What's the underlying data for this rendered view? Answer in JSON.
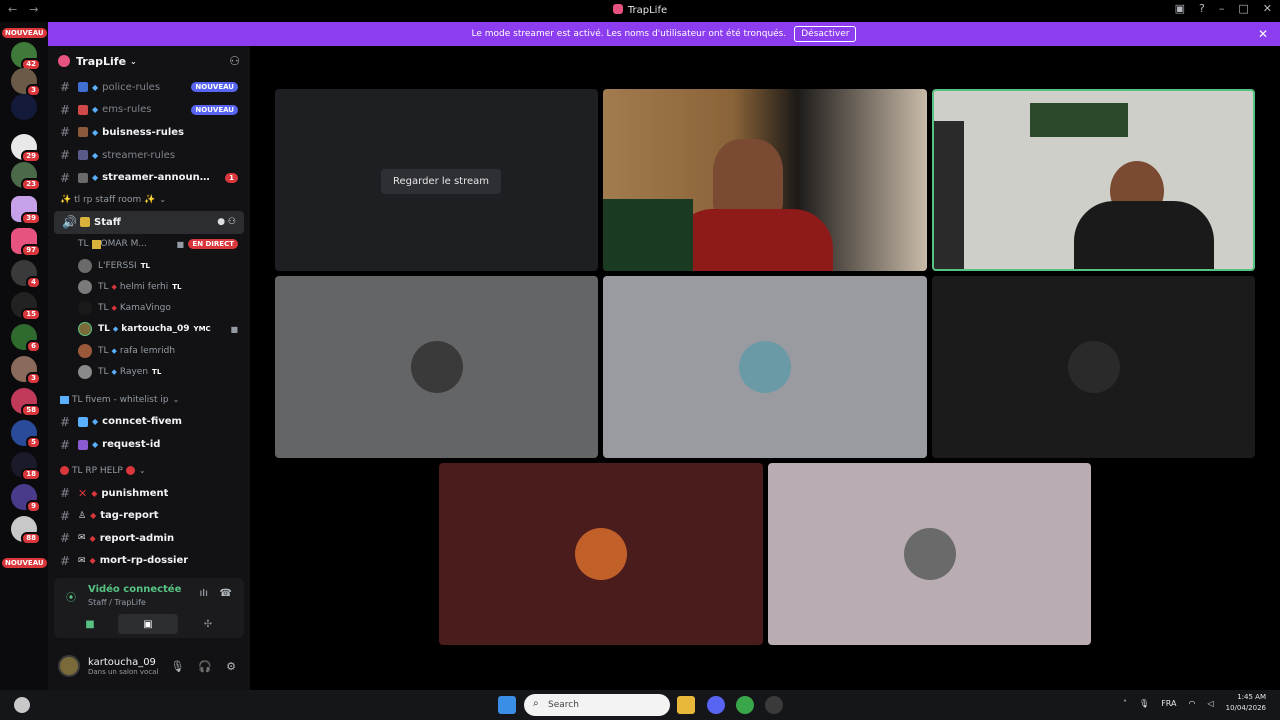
{
  "window": {
    "title": "TrapLife",
    "back_icon": "←",
    "forward_icon": "→"
  },
  "banner": {
    "text": "Le mode streamer est activé. Les noms d'utilisateur ont été tronqués.",
    "button": "Désactiver"
  },
  "rail": {
    "new_top": "NOUVEAU",
    "new_bottom": "NOUVEAU",
    "badges": [
      "42",
      "3",
      "29",
      "23",
      "39",
      "97",
      "4",
      "15",
      "6",
      "3",
      "58",
      "5",
      "18",
      "9",
      "88"
    ]
  },
  "guild": {
    "name": "TrapLife"
  },
  "channels_top": [
    {
      "name": "police-rules",
      "badge": "NOUVEAU",
      "bold": false
    },
    {
      "name": "ems-rules",
      "badge": "NOUVEAU",
      "bold": false
    },
    {
      "name": "buisness-rules",
      "badge": "",
      "bold": true
    },
    {
      "name": "streamer-rules",
      "badge": "",
      "bold": false
    },
    {
      "name": "streamer-announcem...",
      "badge": "",
      "count": "1",
      "bold": true
    }
  ],
  "category_staff": "✨ tl rp staff room ✨",
  "voice_channel": {
    "name": "Staff",
    "users": [
      {
        "prefix": "TL",
        "name": "OMAR M...",
        "tag": "",
        "live": "EN DIRECT"
      },
      {
        "prefix": "",
        "name": "L'FERSSI",
        "tag": "TL",
        "live": ""
      },
      {
        "prefix": "TL",
        "name": "helmi ferhi",
        "tag": "TL",
        "live": ""
      },
      {
        "prefix": "TL",
        "name": "KamaVingo",
        "tag": "",
        "live": ""
      },
      {
        "prefix": "TL",
        "name": "kartoucha_09",
        "tag": "YMC",
        "live": ""
      },
      {
        "prefix": "TL",
        "name": "rafa lemridh",
        "tag": "",
        "live": ""
      },
      {
        "prefix": "TL",
        "name": "Rayen",
        "tag": "TL",
        "live": ""
      }
    ]
  },
  "category_fivem": "TL fivem - whitelist ip",
  "channels_fivem": [
    {
      "name": "conncet-fivem"
    },
    {
      "name": "request-id"
    }
  ],
  "category_help": "TL RP HELP",
  "channels_help": [
    {
      "name": "punishment"
    },
    {
      "name": "tag-report"
    },
    {
      "name": "report-admin"
    },
    {
      "name": "mort-rp-dossier"
    }
  ],
  "voice_status": {
    "connected": "Vidéo connectée",
    "location": "Staff / TrapLife"
  },
  "user": {
    "name": "kartoucha_09",
    "status": "Dans un salon vocal"
  },
  "stage": {
    "watch_button": "Regarder le stream"
  },
  "taskbar": {
    "search_placeholder": "Search",
    "lang": "FRA",
    "time": "1:45 AM",
    "date": "10/04/2026"
  }
}
